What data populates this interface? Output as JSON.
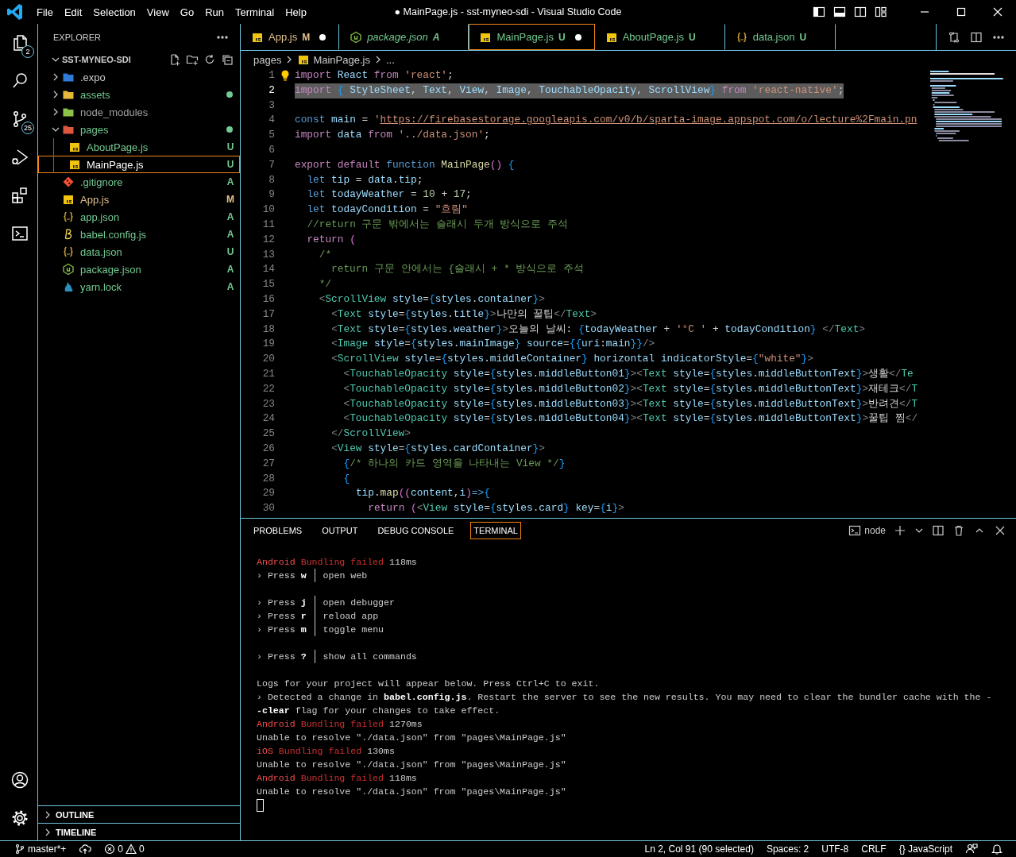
{
  "title_bar": {
    "menu": [
      "File",
      "Edit",
      "Selection",
      "View",
      "Go",
      "Run",
      "Terminal",
      "Help"
    ],
    "title": "● MainPage.js - sst-myneo-sdi - Visual Studio Code"
  },
  "activity_bar": {
    "items": [
      {
        "kind": "explorer",
        "badge": "2"
      },
      {
        "kind": "search"
      },
      {
        "kind": "source-control",
        "badge": "25"
      },
      {
        "kind": "run-debug"
      },
      {
        "kind": "extensions"
      },
      {
        "kind": "terminal"
      }
    ],
    "bottom": [
      {
        "kind": "account"
      },
      {
        "kind": "settings"
      }
    ]
  },
  "sidebar": {
    "title": "EXPLORER",
    "project": {
      "label": "SST-MYNEO-SDI",
      "expanded": true
    },
    "tree": [
      {
        "label": ".expo",
        "kind": "expo-folder",
        "expanded": false,
        "selected": false,
        "modified": false,
        "color": "#cccccc"
      },
      {
        "label": "assets",
        "kind": "assets-folder",
        "expanded": false,
        "selected": false,
        "modified": true,
        "color": "#73c991"
      },
      {
        "label": "node_modules",
        "kind": "node-folder",
        "expanded": false,
        "selected": false,
        "modified": false,
        "color": "#a0a0a0"
      },
      {
        "label": "pages",
        "kind": "pages-folder",
        "expanded": true,
        "selected": false,
        "modified": true,
        "color": "#73c991",
        "children": [
          {
            "label": "AboutPage.js",
            "kind": "js",
            "selected": false,
            "status": "U",
            "color": "#73c991"
          },
          {
            "label": "MainPage.js",
            "kind": "js",
            "selected": true,
            "status": "U",
            "color": "#73c991"
          }
        ]
      },
      {
        "label": ".gitignore",
        "kind": "git",
        "selected": false,
        "status": "A",
        "color": "#73c991"
      },
      {
        "label": "App.js",
        "kind": "js",
        "selected": false,
        "status": "M",
        "color": "#e2c08d"
      },
      {
        "label": "app.json",
        "kind": "json",
        "selected": false,
        "status": "A",
        "color": "#73c991"
      },
      {
        "label": "babel.config.js",
        "kind": "babel",
        "selected": false,
        "status": "A",
        "color": "#73c991"
      },
      {
        "label": "data.json",
        "kind": "json",
        "selected": false,
        "status": "U",
        "color": "#73c991"
      },
      {
        "label": "package.json",
        "kind": "npm",
        "selected": false,
        "status": "A",
        "color": "#73c991"
      },
      {
        "label": "yarn.lock",
        "kind": "yarn",
        "selected": false,
        "status": "A",
        "color": "#73c991"
      }
    ],
    "sections": [
      {
        "label": "OUTLINE",
        "expanded": false
      },
      {
        "label": "TIMELINE",
        "expanded": false
      }
    ]
  },
  "editor": {
    "tabs": [
      {
        "label": "App.js",
        "kind": "js",
        "status": "M",
        "color": "#e2c08d",
        "dirty": true,
        "preview": false,
        "selected": false
      },
      {
        "label": "package.json",
        "kind": "npm",
        "status": "A",
        "color": "#73c991",
        "dirty": false,
        "preview": true,
        "selected": false
      },
      {
        "label": "MainPage.js",
        "kind": "js",
        "status": "U",
        "color": "#73c991",
        "dirty": true,
        "preview": false,
        "selected": true
      },
      {
        "label": "AboutPage.js",
        "kind": "js",
        "status": "U",
        "color": "#73c991",
        "dirty": false,
        "preview": false,
        "selected": false
      },
      {
        "label": "data.json",
        "kind": "json",
        "status": "U",
        "color": "#73c991",
        "dirty": false,
        "preview": false,
        "selected": false
      }
    ],
    "breadcrumb": [
      {
        "label": "pages",
        "kind": "folder"
      },
      {
        "label": "MainPage.js",
        "kind": "js"
      },
      {
        "label": "...",
        "kind": "symbol"
      }
    ],
    "lines": [
      {
        "num": "1",
        "text": "import React from 'react';",
        "selected": false,
        "lightbulb": true
      },
      {
        "num": "2",
        "text": "import { StyleSheet, Text, View, Image, TouchableOpacity, ScrollView} from 'react-native';",
        "selected": true
      },
      {
        "num": "3",
        "selected": false
      },
      {
        "num": "4",
        "text": "const main = 'https://firebasestorage.googleapis.com/v0/b/sparta-image.appspot.com/o/lecture%2Fmain.pn",
        "selected": false
      },
      {
        "num": "5",
        "text": "import data from '../data.json';",
        "selected": false
      },
      {
        "num": "6",
        "selected": false
      },
      {
        "num": "7",
        "text": "export default function MainPage() {",
        "selected": false
      },
      {
        "num": "8",
        "text": "  let tip = data.tip;",
        "selected": false
      },
      {
        "num": "9",
        "text": "  let todayWeather = 10 + 17;",
        "selected": false
      },
      {
        "num": "10",
        "text": "  let todayCondition = \"흐림\"",
        "selected": false
      },
      {
        "num": "11",
        "text": "  //return 구문 밖에서는 슬래시 두개 방식으로 주석",
        "selected": false
      },
      {
        "num": "12",
        "text": "  return (",
        "selected": false
      },
      {
        "num": "13",
        "text": "    /*",
        "selected": false
      },
      {
        "num": "14",
        "text": "      return 구문 안에서는 {슬래시 + * 방식으로 주석",
        "selected": false
      },
      {
        "num": "15",
        "text": "    */",
        "selected": false
      },
      {
        "num": "16",
        "text": "    <ScrollView style={styles.container}>",
        "selected": false
      },
      {
        "num": "17",
        "text": "      <Text style={styles.title}>나만의 꿀팁</Text>",
        "selected": false
      },
      {
        "num": "18",
        "text": "      <Text style={styles.weather}>오늘의 날씨: {todayWeather + '°C ' + todayCondition} </Text>",
        "selected": false
      },
      {
        "num": "19",
        "text": "      <Image style={styles.mainImage} source={{uri:main}}/>",
        "selected": false
      },
      {
        "num": "20",
        "text": "      <ScrollView style={styles.middleContainer} horizontal indicatorStyle={\"white\"}>",
        "selected": false
      },
      {
        "num": "21",
        "text": "        <TouchableOpacity style={styles.middleButton01}><Text style={styles.middleButtonText}>생활</Te",
        "selected": false
      },
      {
        "num": "22",
        "text": "        <TouchableOpacity style={styles.middleButton02}><Text style={styles.middleButtonText}>재테크</T",
        "selected": false
      },
      {
        "num": "23",
        "text": "        <TouchableOpacity style={styles.middleButton03}><Text style={styles.middleButtonText}>반려견</T",
        "selected": false
      },
      {
        "num": "24",
        "text": "        <TouchableOpacity style={styles.middleButton04}><Text style={styles.middleButtonText}>꿀팁 찜</",
        "selected": false
      },
      {
        "num": "25",
        "text": "      </ScrollView>",
        "selected": false
      },
      {
        "num": "26",
        "text": "      <View style={styles.cardContainer}>",
        "selected": false
      },
      {
        "num": "27",
        "text": "        {/* 하나의 카드 영역을 나타내는 View */}",
        "selected": false
      },
      {
        "num": "28",
        "text": "        {",
        "selected": false
      },
      {
        "num": "29",
        "text": "          tip.map((content,i)=>{",
        "selected": false
      },
      {
        "num": "30",
        "text": "            return (<View style={styles.card} key={i}>",
        "selected": false
      }
    ]
  },
  "panel": {
    "tabs": [
      {
        "label": "PROBLEMS",
        "selected": false
      },
      {
        "label": "OUTPUT",
        "selected": false
      },
      {
        "label": "DEBUG CONSOLE",
        "selected": false
      },
      {
        "label": "TERMINAL",
        "selected": true
      }
    ],
    "terminal_name": "node",
    "terminal": [
      {
        "kind": "bundle",
        "platform": "Android",
        "status": "Bundling failed",
        "time": "118ms"
      },
      {
        "kind": "key",
        "prefix": "› Press",
        "key": "w",
        "action": "open web"
      },
      {
        "kind": "blank"
      },
      {
        "kind": "key",
        "prefix": "› Press",
        "key": "j",
        "action": "open debugger"
      },
      {
        "kind": "key",
        "prefix": "› Press",
        "key": "r",
        "action": "reload app"
      },
      {
        "kind": "key",
        "prefix": "› Press",
        "key": "m",
        "action": "toggle menu"
      },
      {
        "kind": "blank"
      },
      {
        "kind": "key",
        "prefix": "› Press",
        "key": "?",
        "action": "show all commands"
      },
      {
        "kind": "blank"
      },
      {
        "kind": "text",
        "text": "Logs for your project will appear below. Press Ctrl+C to exit."
      },
      {
        "kind": "text",
        "text": "› Detected a change in **babel.config.js**. Restart the server to see the new results. You may need to clear the bundler cache with the -"
      },
      {
        "kind": "text",
        "text": "**-clear** flag for your changes to take effect."
      },
      {
        "kind": "bundle",
        "platform": "Android",
        "status": "Bundling failed",
        "time": "1270ms"
      },
      {
        "kind": "text",
        "text": "Unable to resolve \"./data.json\" from \"pages\\MainPage.js\""
      },
      {
        "kind": "bundle",
        "platform": "iOS",
        "status": "Bundling failed",
        "time": "130ms"
      },
      {
        "kind": "text",
        "text": "Unable to resolve \"./data.json\" from \"pages\\MainPage.js\""
      },
      {
        "kind": "bundle",
        "platform": "Android",
        "status": "Bundling failed",
        "time": "118ms"
      },
      {
        "kind": "text",
        "text": "Unable to resolve \"./data.json\" from \"pages\\MainPage.js\""
      },
      {
        "kind": "cursor"
      }
    ]
  },
  "status_bar": {
    "left": [
      {
        "kind": "branch",
        "text": "master*+"
      },
      {
        "kind": "sync"
      },
      {
        "kind": "problems",
        "errors": "0",
        "warnings": "0"
      }
    ],
    "right": [
      {
        "kind": "text",
        "text": "Ln 2, Col 91 (90 selected)"
      },
      {
        "kind": "text",
        "text": "Spaces: 2"
      },
      {
        "kind": "text",
        "text": "UTF-8"
      },
      {
        "kind": "text",
        "text": "CRLF"
      },
      {
        "kind": "language",
        "icon": "{}",
        "text": "JavaScript"
      },
      {
        "kind": "feedback"
      },
      {
        "kind": "bell"
      }
    ]
  }
}
